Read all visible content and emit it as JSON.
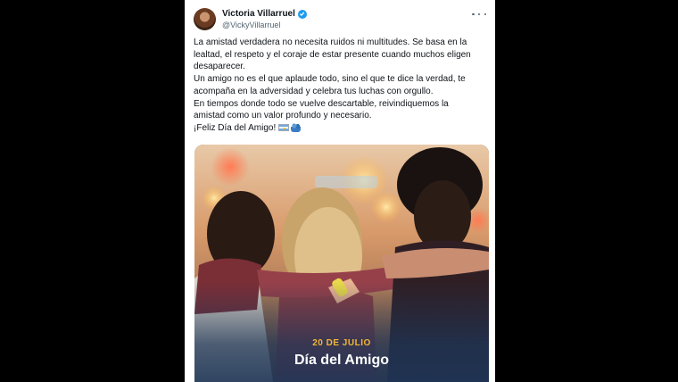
{
  "post": {
    "author_name": "Victoria Villarruel",
    "author_handle": "@VickyVillarruel",
    "lines": [
      "La amistad verdadera no necesita ruidos ni multitudes. Se basa en la",
      "lealtad, el respeto y el coraje de estar presente cuando muchos eligen",
      "desaparecer.",
      "Un amigo no es el que aplaude todo, sino el que te dice la verdad, te",
      "acompaña en la adversidad y celebra tus luchas con orgullo.",
      "En tiempos donde todo se vuelve descartable, reivindiquemos la",
      "amistad como un valor profundo y necesario."
    ],
    "closing": "¡Feliz Día del Amigo!"
  },
  "icons": {
    "verified": "verified-badge-icon",
    "more": "more-options-icon",
    "flag": "argentina-flag-emoji",
    "hug": "people-hugging-emoji"
  },
  "media": {
    "date": "20 DE JULIO",
    "title": "Día del Amigo"
  },
  "colors": {
    "verified": "#1d9bf0",
    "date_accent": "#f2b733",
    "overlay": "#1d3557"
  }
}
